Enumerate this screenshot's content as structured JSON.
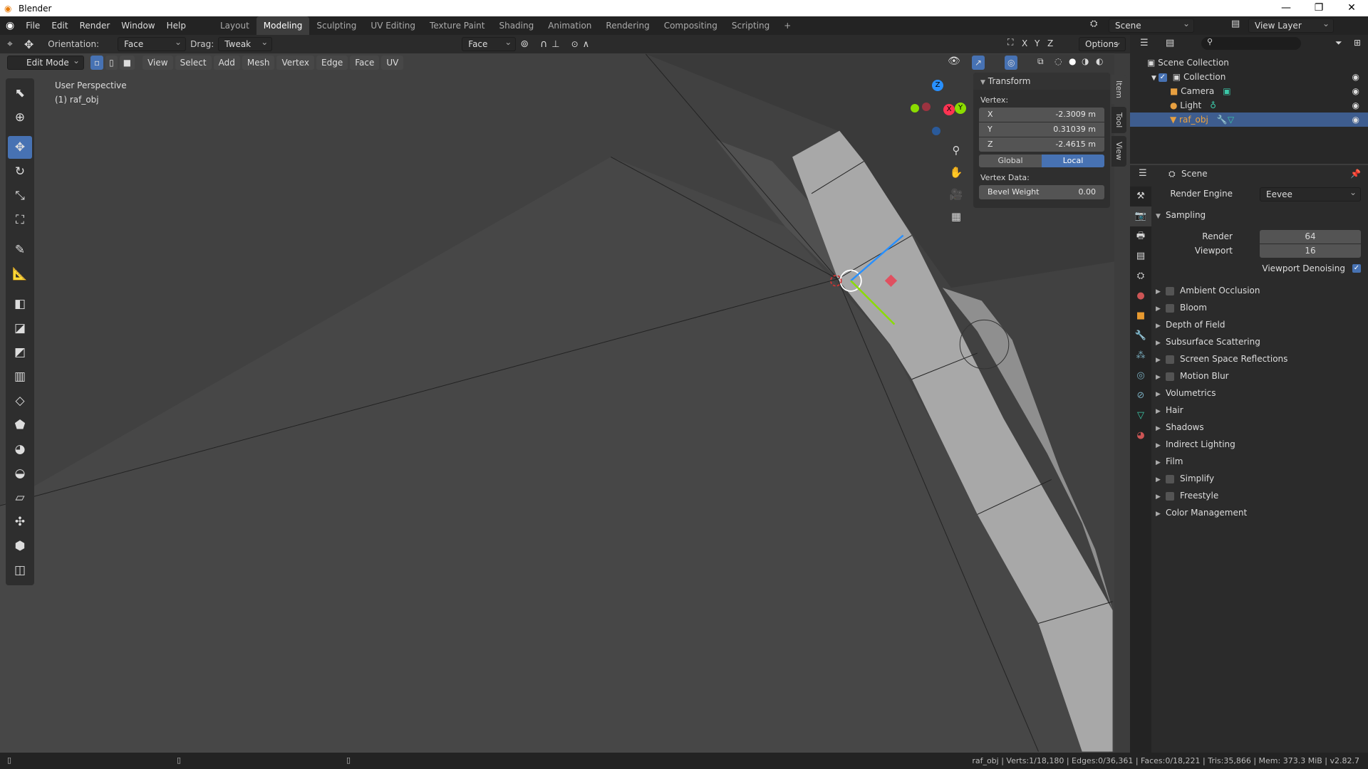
{
  "window": {
    "title": "Blender",
    "controls": [
      "—",
      "❐",
      "✕"
    ]
  },
  "menu": [
    "File",
    "Edit",
    "Render",
    "Window",
    "Help"
  ],
  "workspaces": [
    "Layout",
    "Modeling",
    "Sculpting",
    "UV Editing",
    "Texture Paint",
    "Shading",
    "Animation",
    "Rendering",
    "Compositing",
    "Scripting",
    "+"
  ],
  "active_workspace": "Modeling",
  "scene_name": "Scene",
  "view_layer": "View Layer",
  "tool_header": {
    "orientation_label": "Orientation:",
    "orientation": "Face",
    "drag_label": "Drag:",
    "drag": "Tweak",
    "snap_target": "Face",
    "options": "Options"
  },
  "viewport_header": {
    "mode": "Edit Mode",
    "menus": [
      "View",
      "Select",
      "Add",
      "Mesh",
      "Vertex",
      "Edge",
      "Face",
      "UV"
    ],
    "axes": [
      "X",
      "Y",
      "Z"
    ]
  },
  "viewport": {
    "perspective": "User Perspective",
    "object": "(1) raf_obj",
    "gizmo": {
      "x": "X",
      "y": "Y",
      "z": "Z"
    }
  },
  "tools": [
    "select-box",
    "cursor",
    "move",
    "rotate",
    "scale",
    "transform",
    "annotate",
    "measure",
    "add-cube",
    "extrude",
    "inset",
    "bevel",
    "loop-cut",
    "knife",
    "poly-build",
    "spin",
    "smooth",
    "edge-slide",
    "shrink-fatten",
    "shear",
    "rip"
  ],
  "transform_panel": {
    "title": "Transform",
    "vertex_label": "Vertex:",
    "x": {
      "label": "X",
      "value": "-2.3009 m"
    },
    "y": {
      "label": "Y",
      "value": "0.31039 m"
    },
    "z": {
      "label": "Z",
      "value": "-2.4615 m"
    },
    "global": "Global",
    "local": "Local",
    "vertex_data_label": "Vertex Data:",
    "bevel_label": "Bevel Weight",
    "bevel_value": "0.00"
  },
  "n_tabs": [
    "Item",
    "Tool",
    "View"
  ],
  "outliner": {
    "root": "Scene Collection",
    "items": [
      {
        "name": "Collection"
      },
      {
        "name": "Camera"
      },
      {
        "name": "Light"
      },
      {
        "name": "raf_obj"
      }
    ]
  },
  "properties": {
    "context": "Scene",
    "render_engine_label": "Render Engine",
    "render_engine": "Eevee",
    "sampling": "Sampling",
    "render_label": "Render",
    "render_value": "64",
    "viewport_label": "Viewport",
    "viewport_value": "16",
    "denoise_label": "Viewport Denoising",
    "panels": [
      {
        "name": "Ambient Occlusion",
        "check": true
      },
      {
        "name": "Bloom",
        "check": true
      },
      {
        "name": "Depth of Field",
        "check": false
      },
      {
        "name": "Subsurface Scattering",
        "check": false
      },
      {
        "name": "Screen Space Reflections",
        "check": true
      },
      {
        "name": "Motion Blur",
        "check": true
      },
      {
        "name": "Volumetrics",
        "check": false
      },
      {
        "name": "Hair",
        "check": false
      },
      {
        "name": "Shadows",
        "check": false
      },
      {
        "name": "Indirect Lighting",
        "check": false
      },
      {
        "name": "Film",
        "check": false
      },
      {
        "name": "Simplify",
        "check": true
      },
      {
        "name": "Freestyle",
        "check": true
      },
      {
        "name": "Color Management",
        "check": false
      }
    ]
  },
  "status": "raf_obj | Verts:1/18,180 | Edges:0/36,361 | Faces:0/18,221 | Tris:35,866 | Mem: 373.3 MiB | v2.82.7",
  "colors": {
    "accent": "#4772b3",
    "selected_object": "#f1a33b",
    "x_axis": "#ff3352",
    "y_axis": "#8bdc00",
    "z_axis": "#2890ff"
  }
}
